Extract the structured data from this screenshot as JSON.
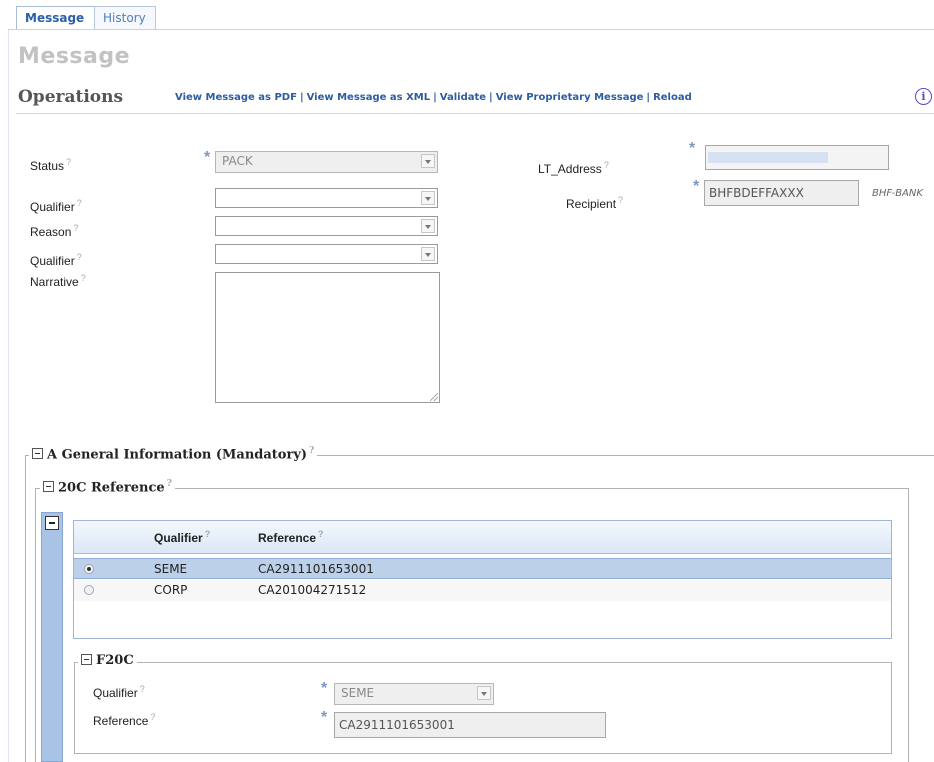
{
  "tabs": [
    {
      "label": "Message"
    },
    {
      "label": "History"
    }
  ],
  "page_title": "Message",
  "operations": {
    "title": "Operations",
    "links": [
      "View Message as PDF",
      "View Message as XML",
      "Validate",
      "View Proprietary Message",
      "Reload"
    ],
    "separator": "|",
    "info_icon": "i"
  },
  "form": {
    "status_label": "Status",
    "status_value": "PACK",
    "qualifier_label": "Qualifier",
    "reason_label": "Reason",
    "qualifier2_label": "Qualifier",
    "narrative_label": "Narrative",
    "lt_address_label": "LT_Address",
    "recipient_label": "Recipient",
    "recipient_value": "BHFBDEFFAXXX",
    "recipient_side": "BHF-BANK",
    "required_mark": "*",
    "help_mark": "?"
  },
  "section_a": {
    "title": "A General Information (Mandatory)",
    "subsection_title": "20C Reference",
    "grid": {
      "columns": [
        "Qualifier",
        "Reference"
      ],
      "rows": [
        {
          "qualifier": "SEME",
          "reference": "CA2911101653001",
          "selected": true
        },
        {
          "qualifier": "CORP",
          "reference": "CA201004271512",
          "selected": false
        }
      ]
    },
    "f20c": {
      "title": "F20C",
      "qualifier_label": "Qualifier",
      "qualifier_value": "SEME",
      "reference_label": "Reference",
      "reference_value": "CA2911101653001"
    }
  },
  "colors": {
    "accent": "#2d5ca0",
    "selected_row": "#bcd0ea",
    "required": "#7b97c4",
    "sidebar": "#a9c3e6"
  }
}
